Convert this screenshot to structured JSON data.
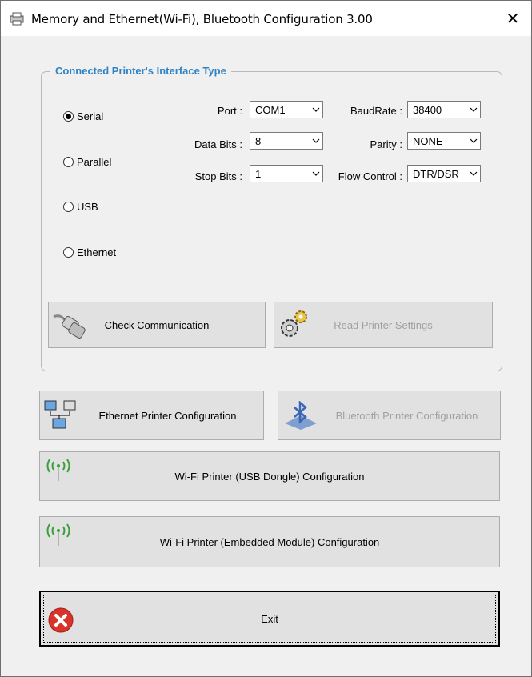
{
  "window": {
    "title": "Memory and Ethernet(Wi-Fi), Bluetooth Configuration 3.00",
    "close_glyph": "✕"
  },
  "group": {
    "title": "Connected Printer's Interface Type",
    "radios": [
      {
        "label": "Serial",
        "checked": true
      },
      {
        "label": "Parallel",
        "checked": false
      },
      {
        "label": "USB",
        "checked": false
      },
      {
        "label": "Ethernet",
        "checked": false
      }
    ],
    "fields": {
      "port": {
        "label": "Port :",
        "value": "COM1"
      },
      "baudrate": {
        "label": "BaudRate :",
        "value": "38400"
      },
      "databits": {
        "label": "Data Bits :",
        "value": "8"
      },
      "parity": {
        "label": "Parity :",
        "value": "NONE"
      },
      "stopbits": {
        "label": "Stop Bits :",
        "value": "1"
      },
      "flowcontrol": {
        "label": "Flow Control :",
        "value": "DTR/DSR"
      }
    },
    "check_comm_label": "Check Communication",
    "read_settings_label": "Read Printer Settings"
  },
  "buttons": {
    "ethernet": "Ethernet Printer Configuration",
    "bluetooth": "Bluetooth Printer Configuration",
    "wifi_usb": "Wi-Fi Printer (USB Dongle) Configuration",
    "wifi_embedded": "Wi-Fi Printer (Embedded Module) Configuration",
    "exit": "Exit"
  },
  "icons": {
    "app": "printer-icon",
    "serial_cable": "serial-cable-icon",
    "gear": "gear-icon",
    "network": "network-computers-icon",
    "bluetooth": "bluetooth-icon",
    "wifi": "wifi-antenna-icon",
    "exit": "exit-x-icon"
  },
  "colors": {
    "group_title": "#2f83c4",
    "exit_icon": "#d9332b",
    "wifi_icon": "#3aa03a",
    "bluetooth_icon": "#3a66b5"
  }
}
